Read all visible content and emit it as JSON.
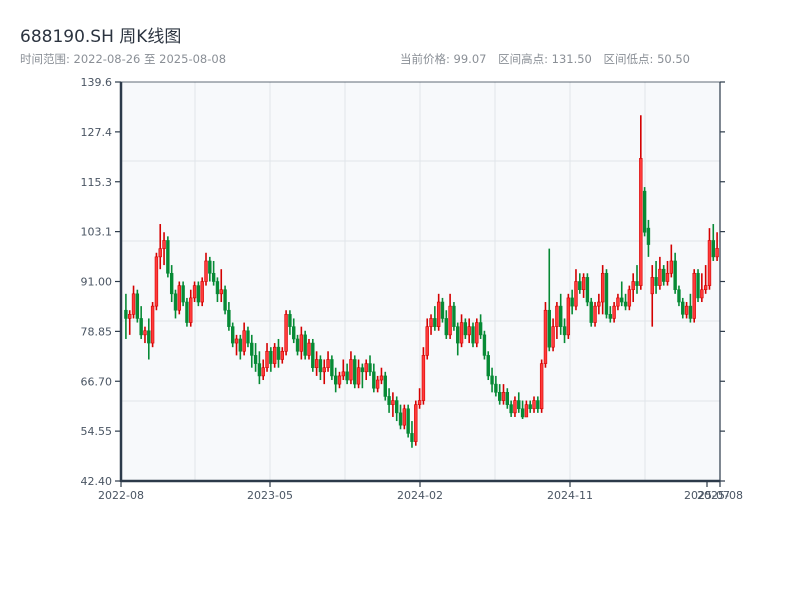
{
  "header": {
    "title": "688190.SH 周K线图",
    "range_label": "时间范围: 2022-08-26 至 2025-08-08",
    "current_price": "当前价格: 99.07",
    "range_high": "区间高点: 131.50",
    "range_low": "区间低点: 50.50"
  },
  "colors": {
    "up": "#d40000",
    "up_fill": "#ff3b3b",
    "down": "#068a35",
    "plot_bg": "#f7f9fb",
    "axis": "#2c3a4a",
    "grid": "#e1e5ea"
  },
  "chart_data": {
    "type": "candlestick",
    "title": "688190.SH 周K线图",
    "xlabel": "",
    "ylabel": "",
    "ylim": [
      42.4,
      139.6
    ],
    "y_ticks": [
      "42.40",
      "54.55",
      "66.70",
      "78.85",
      "91.00",
      "103.1",
      "115.3",
      "127.4",
      "139.6"
    ],
    "x_ticks": [
      "2022-08",
      "2023-05",
      "2024-02",
      "2024-11",
      "2025-07",
      "2025-08"
    ],
    "x_range": [
      "2022-08-26",
      "2025-08-08"
    ],
    "grid": true,
    "up_color_meaning": "red = close above open",
    "ohlc_fields": [
      "open",
      "high",
      "low",
      "close"
    ],
    "ohlc": [
      [
        84,
        88,
        77,
        82
      ],
      [
        82,
        84,
        78,
        83
      ],
      [
        83,
        90,
        82,
        88
      ],
      [
        88,
        89,
        81,
        82
      ],
      [
        82,
        85,
        77,
        78
      ],
      [
        78,
        80,
        76,
        79
      ],
      [
        79,
        82,
        72,
        76
      ],
      [
        76,
        86,
        75,
        85
      ],
      [
        85,
        98,
        84,
        97
      ],
      [
        97,
        105,
        94,
        99
      ],
      [
        99,
        103,
        95,
        101
      ],
      [
        101,
        102,
        92,
        93
      ],
      [
        93,
        95,
        86,
        88
      ],
      [
        88,
        89,
        82,
        84
      ],
      [
        84,
        91,
        83,
        90
      ],
      [
        90,
        91,
        85,
        86
      ],
      [
        86,
        87,
        80,
        81
      ],
      [
        81,
        89,
        80,
        87
      ],
      [
        87,
        91,
        86,
        90
      ],
      [
        90,
        91,
        85,
        86
      ],
      [
        86,
        92,
        85,
        91
      ],
      [
        91,
        98,
        90,
        96
      ],
      [
        96,
        97,
        91,
        93
      ],
      [
        93,
        96,
        90,
        91
      ],
      [
        91,
        92,
        86,
        88
      ],
      [
        88,
        94,
        86,
        89
      ],
      [
        89,
        90,
        83,
        84
      ],
      [
        84,
        86,
        79,
        80
      ],
      [
        80,
        81,
        75,
        76
      ],
      [
        76,
        78,
        73,
        77
      ],
      [
        77,
        78,
        72,
        74
      ],
      [
        74,
        81,
        73,
        79
      ],
      [
        79,
        80,
        75,
        76
      ],
      [
        76,
        78,
        70,
        73
      ],
      [
        73,
        76,
        69,
        71
      ],
      [
        71,
        74,
        66,
        68
      ],
      [
        68,
        72,
        67,
        70
      ],
      [
        70,
        76,
        69,
        74
      ],
      [
        74,
        75,
        69,
        71
      ],
      [
        71,
        76,
        70,
        75
      ],
      [
        75,
        77,
        70,
        72
      ],
      [
        72,
        75,
        71,
        74
      ],
      [
        74,
        84,
        73,
        83
      ],
      [
        83,
        84,
        78,
        80
      ],
      [
        80,
        82,
        76,
        77
      ],
      [
        77,
        78,
        73,
        74
      ],
      [
        74,
        80,
        72,
        78
      ],
      [
        78,
        79,
        72,
        73
      ],
      [
        73,
        77,
        72,
        76
      ],
      [
        76,
        77,
        69,
        70
      ],
      [
        70,
        74,
        68,
        72
      ],
      [
        72,
        73,
        67,
        69
      ],
      [
        69,
        72,
        66,
        70
      ],
      [
        70,
        74,
        69,
        72
      ],
      [
        72,
        73,
        67,
        68
      ],
      [
        68,
        70,
        64,
        66
      ],
      [
        66,
        69,
        65,
        68
      ],
      [
        68,
        72,
        67,
        69
      ],
      [
        69,
        71,
        66,
        67
      ],
      [
        67,
        74,
        66,
        72
      ],
      [
        72,
        73,
        65,
        66
      ],
      [
        66,
        72,
        65,
        70
      ],
      [
        70,
        71,
        65,
        69
      ],
      [
        69,
        72,
        67,
        71
      ],
      [
        71,
        73,
        68,
        69
      ],
      [
        69,
        71,
        64,
        65
      ],
      [
        65,
        68,
        64,
        67
      ],
      [
        67,
        70,
        66,
        68
      ],
      [
        68,
        69,
        62,
        63
      ],
      [
        63,
        65,
        59,
        61
      ],
      [
        61,
        64,
        58,
        62
      ],
      [
        62,
        63,
        57,
        59
      ],
      [
        59,
        61,
        55,
        56
      ],
      [
        56,
        61,
        55,
        60
      ],
      [
        60,
        61,
        53,
        54
      ],
      [
        54,
        57,
        50.5,
        52
      ],
      [
        52,
        62,
        51,
        61
      ],
      [
        61,
        65,
        60,
        62
      ],
      [
        62,
        75,
        61,
        73
      ],
      [
        73,
        82,
        72,
        80
      ],
      [
        80,
        83,
        78,
        82
      ],
      [
        82,
        85,
        79,
        80
      ],
      [
        80,
        88,
        79,
        86
      ],
      [
        86,
        87,
        81,
        82
      ],
      [
        82,
        84,
        77,
        78
      ],
      [
        78,
        88,
        77,
        85
      ],
      [
        85,
        86,
        79,
        80
      ],
      [
        80,
        81,
        73,
        76
      ],
      [
        76,
        83,
        75,
        81
      ],
      [
        81,
        82,
        77,
        78
      ],
      [
        78,
        82,
        76,
        80
      ],
      [
        80,
        81,
        75,
        76
      ],
      [
        76,
        82,
        75,
        81
      ],
      [
        81,
        83,
        77,
        78
      ],
      [
        78,
        79,
        72,
        73
      ],
      [
        73,
        74,
        67,
        68
      ],
      [
        68,
        70,
        64,
        66
      ],
      [
        66,
        68,
        63,
        64
      ],
      [
        64,
        66,
        61,
        62
      ],
      [
        62,
        66,
        61,
        64
      ],
      [
        64,
        65,
        60,
        61
      ],
      [
        61,
        62,
        58,
        59
      ],
      [
        59,
        63,
        58,
        62
      ],
      [
        62,
        64,
        59,
        60
      ],
      [
        60,
        62,
        57.5,
        58
      ],
      [
        58,
        62,
        58,
        61
      ],
      [
        61,
        62,
        59,
        60
      ],
      [
        60,
        63,
        59,
        62
      ],
      [
        62,
        63,
        59,
        60
      ],
      [
        60,
        72,
        59,
        71
      ],
      [
        71,
        86,
        70,
        84
      ],
      [
        84,
        99,
        74,
        75
      ],
      [
        75,
        82,
        74,
        80
      ],
      [
        80,
        86,
        77,
        85
      ],
      [
        85,
        88,
        78,
        80
      ],
      [
        80,
        82,
        76,
        78
      ],
      [
        78,
        88,
        77,
        87
      ],
      [
        87,
        89,
        83,
        85
      ],
      [
        85,
        94,
        84,
        91
      ],
      [
        91,
        93,
        88,
        89
      ],
      [
        89,
        93,
        87,
        92
      ],
      [
        92,
        93,
        85,
        86
      ],
      [
        86,
        87,
        80,
        81
      ],
      [
        81,
        86,
        80,
        85
      ],
      [
        85,
        88,
        83,
        86
      ],
      [
        86,
        95,
        83,
        93
      ],
      [
        93,
        94,
        82,
        83
      ],
      [
        83,
        85,
        81,
        82
      ],
      [
        82,
        86,
        81,
        85
      ],
      [
        85,
        88,
        84,
        87
      ],
      [
        87,
        91,
        85,
        86
      ],
      [
        86,
        88,
        84,
        85
      ],
      [
        85,
        90,
        84,
        89
      ],
      [
        89,
        93,
        86,
        91
      ],
      [
        91,
        95,
        88,
        90
      ],
      [
        90,
        131.5,
        89,
        121
      ],
      [
        113,
        114,
        102,
        103
      ],
      [
        104,
        106,
        97,
        100
      ],
      [
        88,
        95,
        80,
        92
      ],
      [
        92,
        96,
        88,
        90
      ],
      [
        90,
        97,
        89,
        94
      ],
      [
        94,
        95,
        90,
        91
      ],
      [
        91,
        96,
        90,
        93
      ],
      [
        93,
        100,
        92,
        96
      ],
      [
        96,
        98,
        88,
        89
      ],
      [
        89,
        90,
        85,
        86
      ],
      [
        86,
        87,
        82,
        83
      ],
      [
        83,
        86,
        82,
        85
      ],
      [
        85,
        88,
        81,
        82
      ],
      [
        82,
        94,
        81,
        93
      ],
      [
        93,
        94,
        86,
        87
      ],
      [
        87,
        93,
        86,
        89
      ],
      [
        89,
        95,
        88,
        90
      ],
      [
        90,
        104,
        89,
        101
      ],
      [
        101,
        105,
        96,
        97
      ],
      [
        97,
        103,
        96,
        99.07
      ]
    ]
  }
}
